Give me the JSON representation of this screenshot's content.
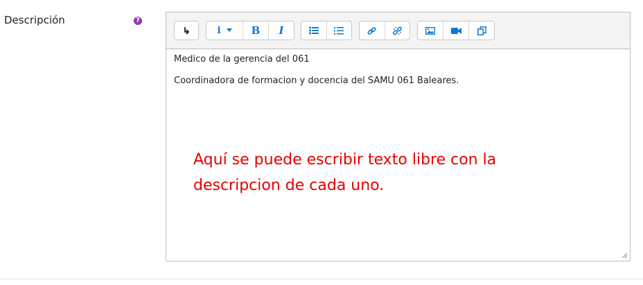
{
  "field": {
    "label": "Descripción",
    "help_icon": "question-circle-icon"
  },
  "toolbar": {
    "groups": [
      {
        "buttons": [
          "collapse-icon"
        ]
      },
      {
        "buttons": [
          "info-dropdown-icon",
          "bold-icon",
          "italic-icon"
        ]
      },
      {
        "buttons": [
          "unordered-list-icon",
          "ordered-list-icon"
        ]
      },
      {
        "buttons": [
          "link-icon",
          "unlink-icon"
        ]
      },
      {
        "buttons": [
          "image-icon",
          "video-icon",
          "media-manager-icon"
        ]
      }
    ],
    "bold_glyph": "B",
    "italic_glyph": "I",
    "info_glyph": "i"
  },
  "editor": {
    "line1": "Medico de la gerencia del 061",
    "line2": "Coordinadora de formacion y docencia del SAMU 061 Baleares."
  },
  "annotation": {
    "text": "Aquí se puede escribir texto libre con la descripcion de cada uno.",
    "color": "#e60000"
  },
  "colors": {
    "icon": "#1177d1",
    "help": "#8e3aa8"
  }
}
